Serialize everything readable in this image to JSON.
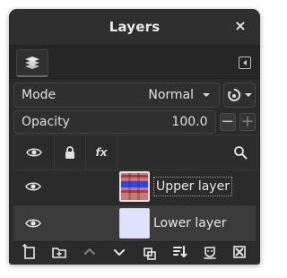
{
  "window": {
    "title": "Layers"
  },
  "mode": {
    "label": "Mode",
    "value": "Normal"
  },
  "opacity": {
    "label": "Opacity",
    "value": "100.0"
  },
  "layers": [
    {
      "name": "Upper layer",
      "visible": true,
      "active": false,
      "name_editing": true
    },
    {
      "name": "Lower layer",
      "visible": true,
      "active": true,
      "name_editing": false
    }
  ],
  "colors": {
    "bg": "#2b2b2b",
    "text": "#e6e6e6",
    "border": "#454545"
  },
  "icons": {
    "close": "close-icon",
    "tab": "layers-stack-icon",
    "tab_menu": "tab-menu-arrow-icon",
    "mode_dropdown": "chevron-down-icon",
    "composite": "composite-mode-icon",
    "minus": "minus-icon",
    "plus": "plus-icon",
    "eye": "eye-icon",
    "lock": "lock-icon",
    "fx": "fx-icon",
    "search": "search-icon",
    "new_layer": "new-layer-icon",
    "new_group": "new-group-icon",
    "raise": "arrow-up-icon",
    "lower": "arrow-down-icon",
    "duplicate": "duplicate-icon",
    "merge": "merge-down-icon",
    "mask": "mask-icon",
    "delete": "delete-icon"
  }
}
